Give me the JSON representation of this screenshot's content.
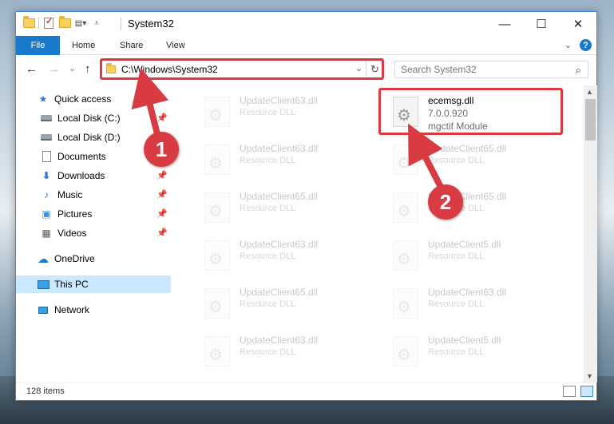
{
  "window": {
    "title": "System32",
    "controls": {
      "minimize": "—",
      "maximize": "☐",
      "close": "✕"
    }
  },
  "ribbon": {
    "tabs": [
      "File",
      "Home",
      "Share",
      "View"
    ],
    "expand_icon": "chevron-down-icon",
    "help_label": "?"
  },
  "navigation": {
    "back": "←",
    "forward": "→",
    "recent": "⌄",
    "up": "↑"
  },
  "address": {
    "path": "C:\\Windows\\System32"
  },
  "search": {
    "placeholder": "Search System32"
  },
  "sidebar": {
    "items": [
      {
        "label": "Quick access",
        "icon": "star-icon",
        "pinned": false
      },
      {
        "label": "Local Disk (C:)",
        "icon": "drive-icon",
        "pinned": true
      },
      {
        "label": "Local Disk (D:)",
        "icon": "drive-icon",
        "pinned": false
      },
      {
        "label": "Documents",
        "icon": "documents-icon",
        "pinned": true
      },
      {
        "label": "Downloads",
        "icon": "download-icon",
        "pinned": true
      },
      {
        "label": "Music",
        "icon": "music-icon",
        "pinned": true
      },
      {
        "label": "Pictures",
        "icon": "pictures-icon",
        "pinned": true
      },
      {
        "label": "Videos",
        "icon": "videos-icon",
        "pinned": true
      },
      {
        "label": "OneDrive",
        "icon": "cloud-icon",
        "pinned": false
      },
      {
        "label": "This PC",
        "icon": "computer-icon",
        "pinned": false,
        "selected": true
      },
      {
        "label": "Network",
        "icon": "network-icon",
        "pinned": false
      }
    ]
  },
  "files": [
    {
      "name": "UpdateClient63.dll",
      "type": "Resource DLL",
      "faded": true
    },
    {
      "name": "ecemsg.dll",
      "version": "7.0.0.920",
      "description": "mgctif Module",
      "faded": false
    },
    {
      "name": "UpdateClient63.dll",
      "type": "Resource DLL",
      "faded": true
    },
    {
      "name": "UpdateClient65.dll",
      "type": "Resource DLL",
      "faded": true
    },
    {
      "name": "UpdateClient65.dll",
      "type": "Resource DLL",
      "faded": true
    },
    {
      "name": "UpdateClient65.dll",
      "type": "Resource DLL",
      "faded": true
    },
    {
      "name": "UpdateClient63.dll",
      "type": "Resource DLL",
      "faded": true
    },
    {
      "name": "UpdateClient5.dll",
      "type": "Resource DLL",
      "faded": true
    },
    {
      "name": "UpdateClient65.dll",
      "type": "Resource DLL",
      "faded": true
    },
    {
      "name": "UpdateClient63.dll",
      "type": "Resource DLL",
      "faded": true
    },
    {
      "name": "UpdateClient63.dll",
      "type": "Resource DLL",
      "faded": true
    },
    {
      "name": "UpdateClient5.dll",
      "type": "Resource DLL",
      "faded": true
    }
  ],
  "status": {
    "item_count": "128 items"
  },
  "callouts": [
    "1",
    "2"
  ],
  "colors": {
    "accent": "#1979ca",
    "highlight": "#d93b42",
    "selection": "#cce8ff"
  }
}
